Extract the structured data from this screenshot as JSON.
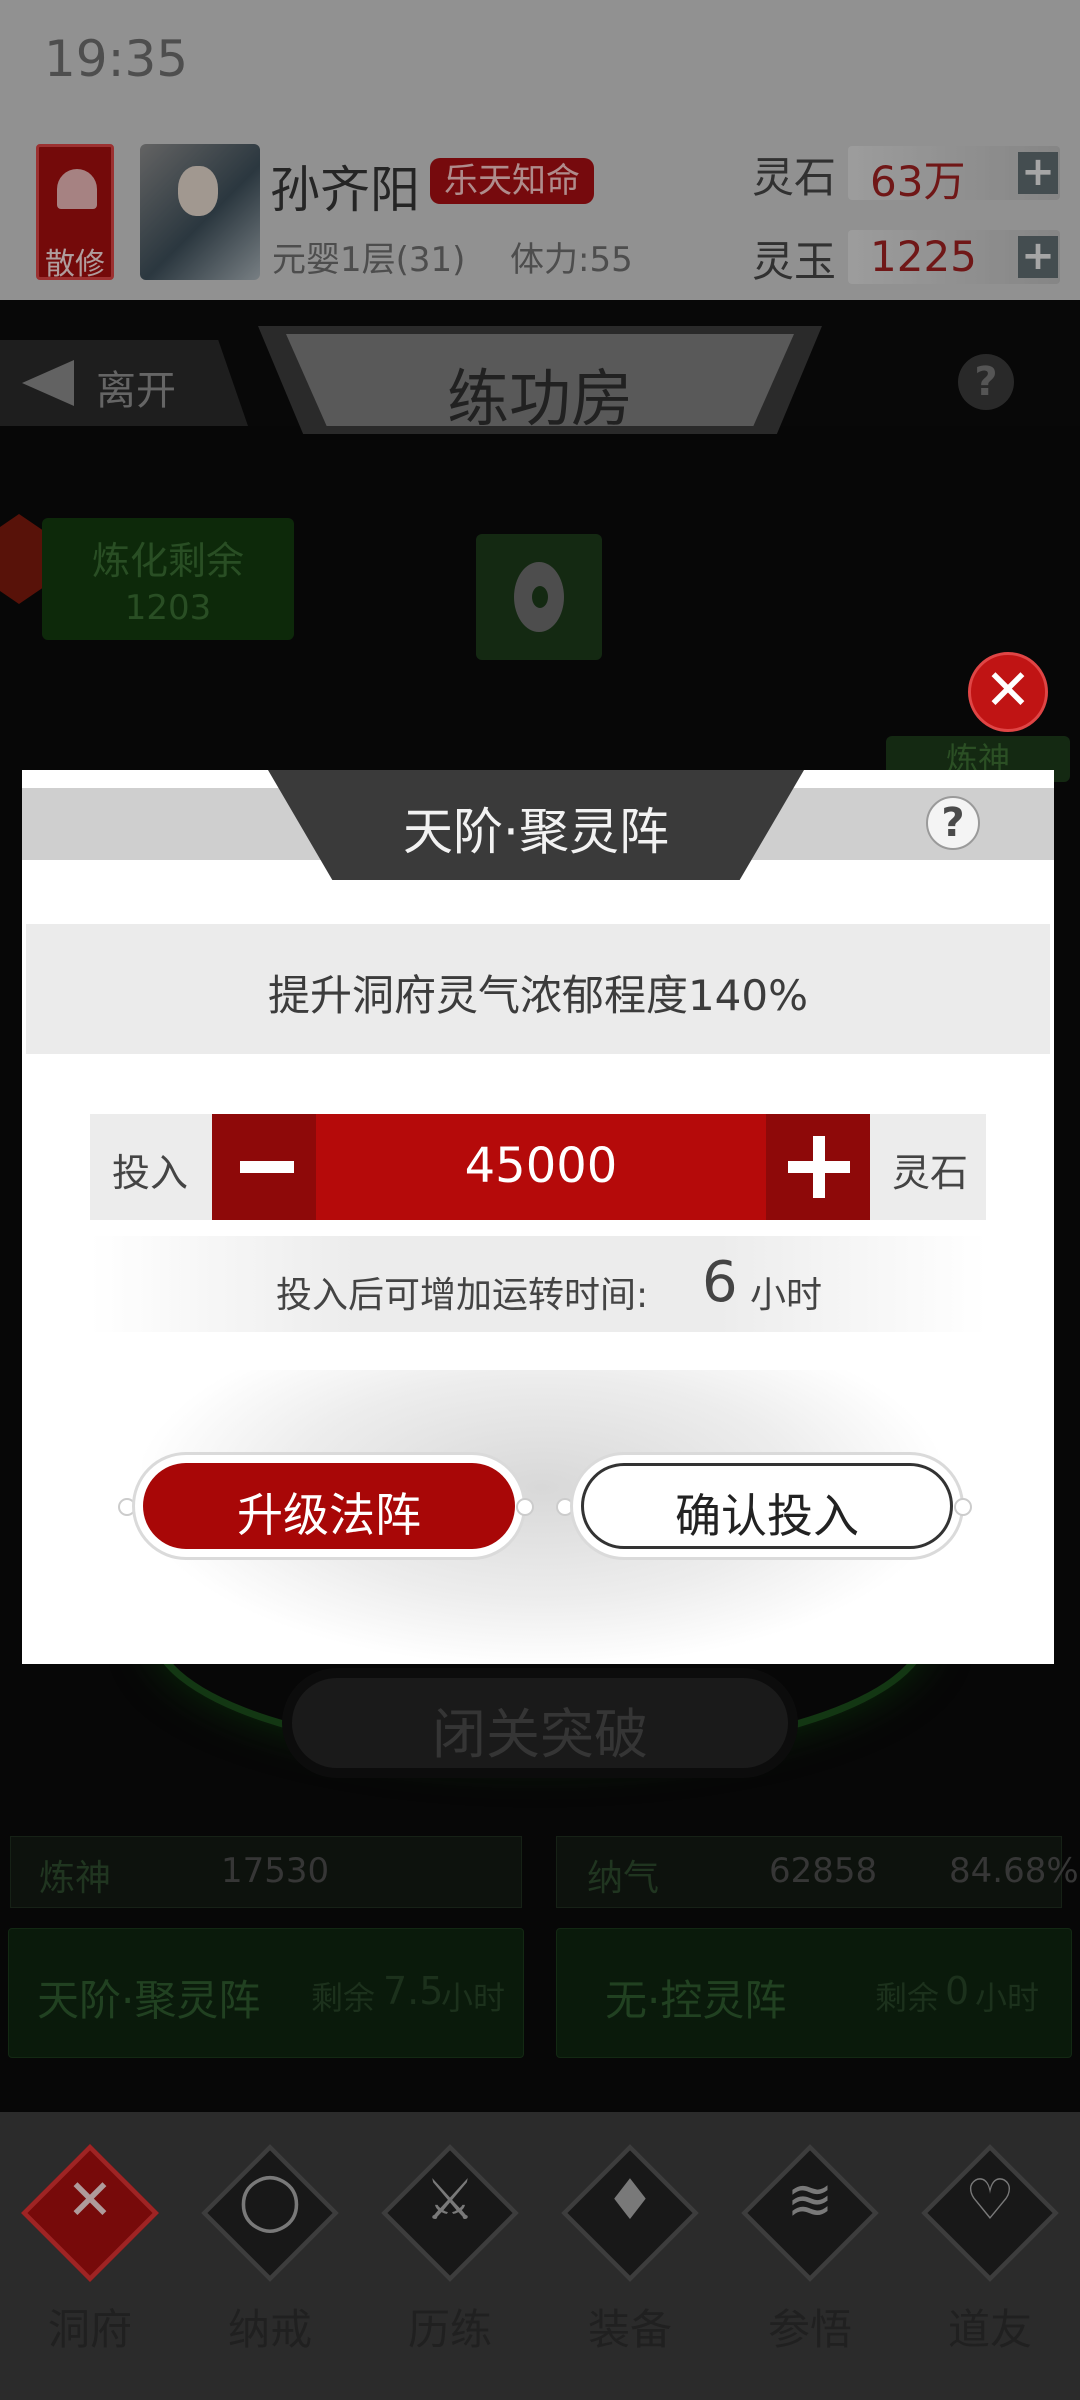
{
  "status_bar": {
    "time": "19:35"
  },
  "player": {
    "sect_label": "散修",
    "name": "孙齐阳",
    "title_tag": "乐天知命",
    "realm": "元婴1层(31)",
    "stamina": "体力:55",
    "resources": [
      {
        "label": "灵石",
        "value": "63万"
      },
      {
        "label": "灵玉",
        "value": "1225"
      }
    ]
  },
  "room": {
    "leave_label": "离开",
    "title": "练功房",
    "help": "?"
  },
  "background": {
    "refine_label": "炼化剩余",
    "refine_value": "1203",
    "right_tag": "炼神",
    "breakout_label": "闭关突破",
    "stats": [
      {
        "name": "炼神",
        "value": "17530",
        "percent": ""
      },
      {
        "name": "纳气",
        "value": "62858",
        "percent": "84.68%"
      }
    ],
    "arrays": [
      {
        "name": "天阶·聚灵阵",
        "remain_prefix": "剩余",
        "remain_value": "7.5",
        "remain_unit": "小时"
      },
      {
        "name": "无·控灵阵",
        "remain_prefix": "剩余",
        "remain_value": "0",
        "remain_unit": "小时"
      }
    ]
  },
  "modal": {
    "title": "天阶·聚灵阵",
    "help": "?",
    "description": "提升洞府灵气浓郁程度140%",
    "invest_label": "投入",
    "amount": "45000",
    "unit": "灵石",
    "time_prefix": "投入后可增加运转时间:",
    "time_value": "6",
    "time_unit": "小时",
    "upgrade_button": "升级法阵",
    "confirm_button": "确认投入",
    "close": "✕"
  },
  "nav": [
    {
      "label": "洞府",
      "icon": "cave-icon",
      "glyph": "✕",
      "active": true
    },
    {
      "label": "纳戒",
      "icon": "ring-icon",
      "glyph": "◯",
      "active": false
    },
    {
      "label": "历练",
      "icon": "swords-icon",
      "glyph": "⚔",
      "active": false
    },
    {
      "label": "装备",
      "icon": "dagger-icon",
      "glyph": "♦",
      "active": false
    },
    {
      "label": "参悟",
      "icon": "scroll-icon",
      "glyph": "≋",
      "active": false
    },
    {
      "label": "道友",
      "icon": "handshake-icon",
      "glyph": "♡",
      "active": false
    }
  ],
  "colors": {
    "accent_red": "#b50a0a",
    "jade_green": "#1b4d1b"
  }
}
